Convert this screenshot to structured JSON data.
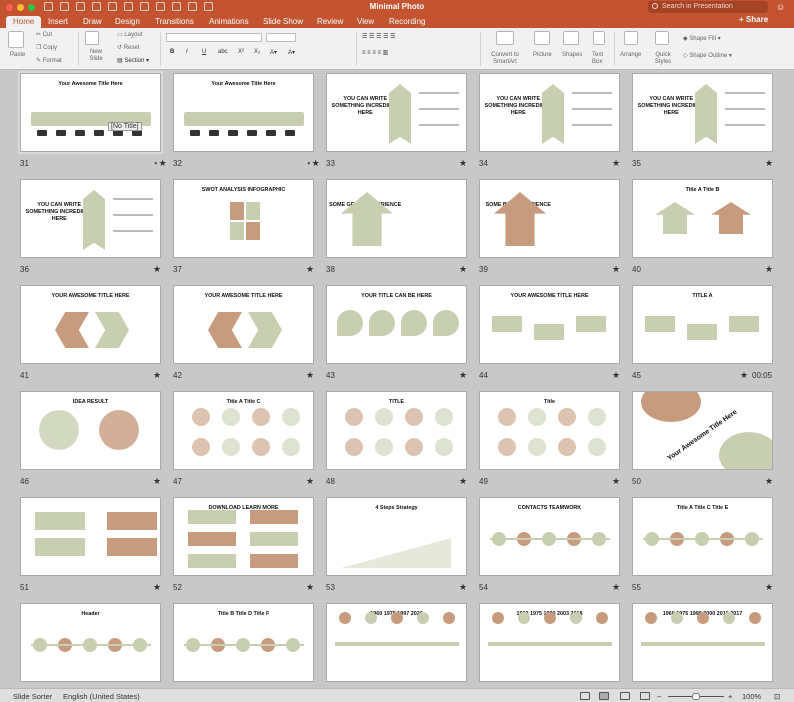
{
  "window": {
    "title": "Minimal Photo"
  },
  "search": {
    "placeholder": "Search in Presentation"
  },
  "share_label": "Share",
  "tabs": [
    "Home",
    "Insert",
    "Draw",
    "Design",
    "Transitions",
    "Animations",
    "Slide Show",
    "Review",
    "View",
    "Recording"
  ],
  "ribbon": {
    "paste": "Paste",
    "cut": "Cut",
    "copy": "Copy",
    "format": "Format",
    "new_slide": "New Slide",
    "layout": "Layout",
    "reset": "Reset",
    "section": "Section",
    "convert_smartart": "Convert to SmartArt",
    "picture": "Picture",
    "shapes": "Shapes",
    "text_box": "Text Box",
    "arrange": "Arrange",
    "quick_styles": "Quick Styles",
    "shape_fill": "Shape Fill",
    "shape_outline": "Shape Outline"
  },
  "slides": [
    {
      "num": "31",
      "title": "Your Awesome Title Here"
    },
    {
      "num": "32",
      "title": "Your Awesome Title Here"
    },
    {
      "num": "33",
      "title": "YOU CAN WRITE SOMETHING INCREDIBLE HERE"
    },
    {
      "num": "34",
      "title": "YOU CAN WRITE SOMETHING INCREDIBLE HERE"
    },
    {
      "num": "35",
      "title": "YOU CAN WRITE SOMETHING INCREDIBLE HERE"
    },
    {
      "num": "36",
      "title": "YOU CAN WRITE SOMETHING INCREDIBLE HERE"
    },
    {
      "num": "37",
      "title": "SWOT ANALYSIS INFOGRAPHIC"
    },
    {
      "num": "38",
      "title": "SOME GREAT EXPERIENCE"
    },
    {
      "num": "39",
      "title": "SOME BAD EXPERIENCE"
    },
    {
      "num": "40",
      "title": "Title A   Title B"
    },
    {
      "num": "41",
      "title": "YOUR AWESOME TITLE HERE"
    },
    {
      "num": "42",
      "title": "YOUR AWESOME TITLE HERE"
    },
    {
      "num": "43",
      "title": "YOUR TITLE CAN BE HERE"
    },
    {
      "num": "44",
      "title": "YOUR AWESOME TITLE HERE"
    },
    {
      "num": "45",
      "title": "TITLE A"
    },
    {
      "num": "46",
      "title": "IDEA   RESULT"
    },
    {
      "num": "47",
      "title": "Title A   Title C"
    },
    {
      "num": "48",
      "title": "TITLE"
    },
    {
      "num": "49",
      "title": "Title"
    },
    {
      "num": "50",
      "title": "Your Awesome Title Here"
    },
    {
      "num": "51",
      "title": ""
    },
    {
      "num": "52",
      "title": "DOWNLOAD   LEARN MORE"
    },
    {
      "num": "53",
      "title": "4 Steps Strategy"
    },
    {
      "num": "54",
      "title": "CONTACTS   TEAMWORK"
    },
    {
      "num": "55",
      "title": "Title A   Title C   Title E"
    },
    {
      "num": "56",
      "title": "Header"
    },
    {
      "num": "57",
      "title": "Title B   Title D   Title F"
    },
    {
      "num": "58",
      "title": "1960   1975   1997   2026"
    },
    {
      "num": "59",
      "title": "1960   1975   1990   2003   2018"
    },
    {
      "num": "60",
      "title": "1960   1975   1990   2000   2010   2017"
    }
  ],
  "tooltip": "[No Title]",
  "timing": "00:05",
  "status": {
    "view": "Slide Sorter",
    "language": "English (United States)",
    "zoom": "100%"
  },
  "colors": {
    "accent": "#c4532f",
    "sage": "#c8ceb0",
    "tan": "#c79c7e"
  }
}
